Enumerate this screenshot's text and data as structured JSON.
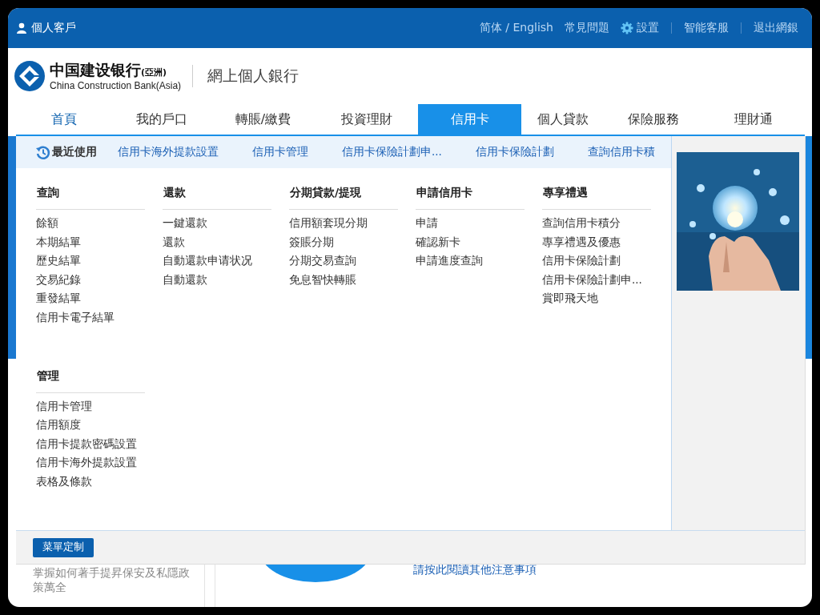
{
  "top_bar": {
    "user_label": "個人客戶",
    "links": [
      {
        "kind": "language",
        "text": "简体 / English"
      },
      {
        "kind": "link",
        "text": "常見問題"
      },
      {
        "kind": "settings",
        "text": "設置"
      },
      {
        "kind": "link",
        "text": "智能客服"
      },
      {
        "kind": "link",
        "text": "退出網銀"
      }
    ]
  },
  "header": {
    "bank_name_cn": "中国建设银行",
    "bank_name_suffix": "(亞洲)",
    "bank_name_en": "China Construction Bank(Asia)",
    "site_title": "網上個人銀行"
  },
  "nav": [
    {
      "label": "首頁",
      "selected": false,
      "current": true
    },
    {
      "label": "我的戶口",
      "selected": false,
      "current": false
    },
    {
      "label": "轉賬/繳費",
      "selected": false,
      "current": false
    },
    {
      "label": "投資理財",
      "selected": false,
      "current": false
    },
    {
      "label": "信用卡",
      "selected": true,
      "current": false
    },
    {
      "label": "個人貸款",
      "selected": false,
      "current": false
    },
    {
      "label": "保險服務",
      "selected": false,
      "current": false
    },
    {
      "label": "理財通",
      "selected": false,
      "current": false
    }
  ],
  "menu": {
    "recent_label": "最近使用",
    "recent_items": [
      "信用卡海外提款設置",
      "信用卡管理",
      "信用卡保險計劃申...",
      "信用卡保險計劃",
      "查詢信用卡積"
    ],
    "groups": [
      {
        "title": "查詢",
        "items": [
          "餘額",
          "本期結單",
          "歷史結單",
          "交易紀錄",
          "重發結單",
          "信用卡電子結單"
        ]
      },
      {
        "title": "還款",
        "items": [
          "一鍵還款",
          "還款",
          "自動還款申请状况",
          "自動還款"
        ]
      },
      {
        "title": "分期貸款/提現",
        "items": [
          "信用額套現分期",
          "簽賬分期",
          "分期交易查詢",
          "免息智快轉賬"
        ]
      },
      {
        "title": "申請信用卡",
        "items": [
          "申請",
          "確認新卡",
          "申請進度查詢"
        ]
      },
      {
        "title": "專享禮遇",
        "items": [
          "查詢信用卡積分",
          "專享禮遇及優惠",
          "信用卡保險計劃",
          "信用卡保險計劃申...",
          "賞即飛天地"
        ]
      },
      {
        "title": "管理",
        "items": [
          "信用卡管理",
          "信用額度",
          "信用卡提款密碼設置",
          "信用卡海外提款設置",
          "表格及條款"
        ]
      }
    ],
    "customize_button": "菜單定制"
  },
  "page_behind": {
    "notice_text": "掌握如何著手提昇保安及私隱政策萬全",
    "notice_link": "請按此閱讀其他注意事項"
  }
}
